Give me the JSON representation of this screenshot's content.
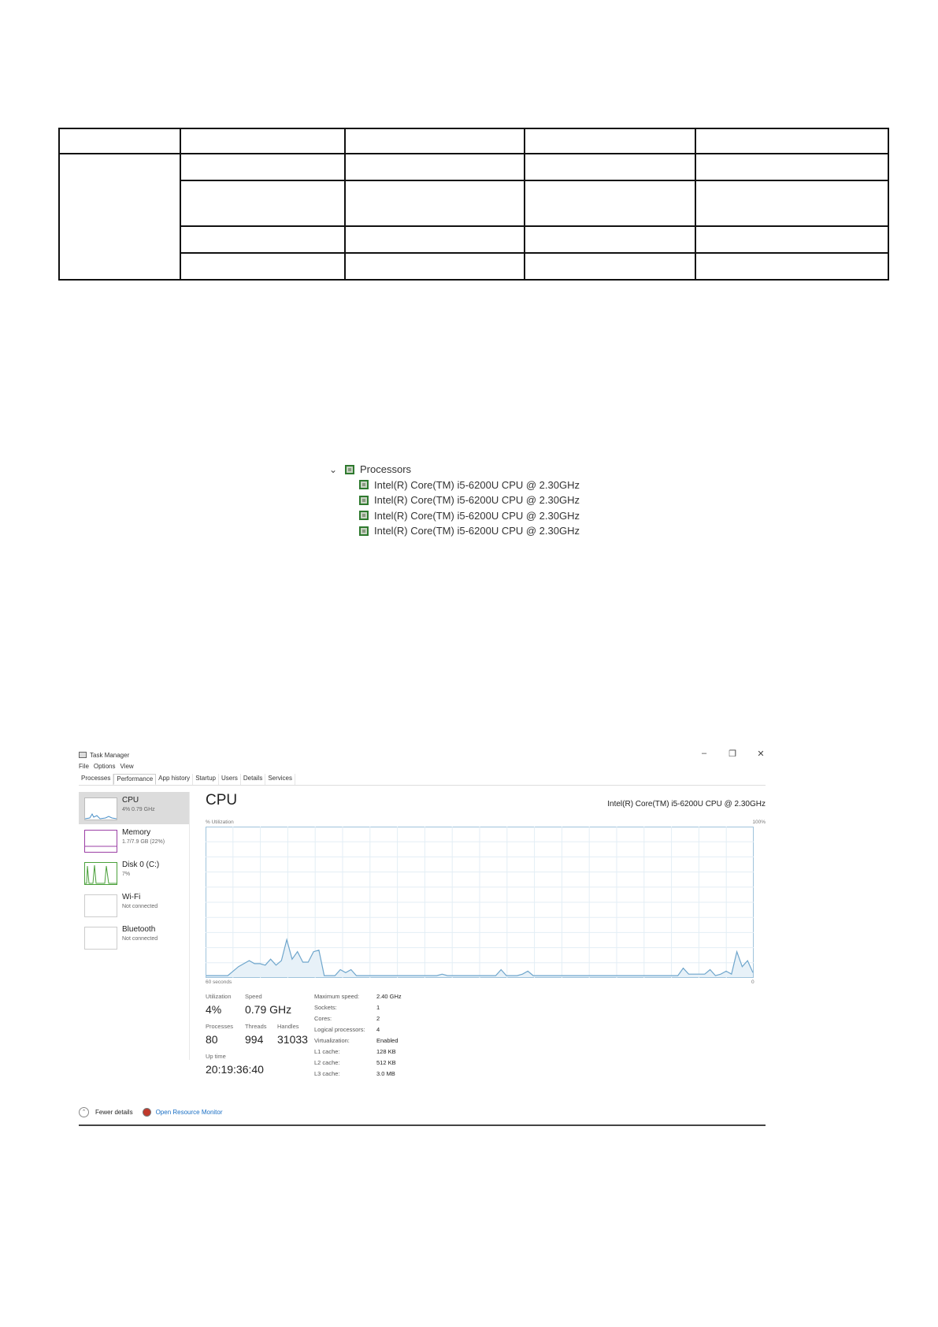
{
  "processors_tree": {
    "root_label": "Processors",
    "children": [
      "Intel(R) Core(TM) i5-6200U CPU @ 2.30GHz",
      "Intel(R) Core(TM) i5-6200U CPU @ 2.30GHz",
      "Intel(R) Core(TM) i5-6200U CPU @ 2.30GHz",
      "Intel(R) Core(TM) i5-6200U CPU @ 2.30GHz"
    ]
  },
  "task_manager": {
    "title": "Task Manager",
    "window_controls": [
      "–",
      "❐",
      "✕"
    ],
    "menu": [
      "File",
      "Options",
      "View"
    ],
    "tabs": [
      "Processes",
      "Performance",
      "App history",
      "Startup",
      "Users",
      "Details",
      "Services"
    ],
    "active_tab": "Performance",
    "sidebar": [
      {
        "name": "CPU",
        "sub": "4% 0.79 GHz",
        "color": "#4a90c8"
      },
      {
        "name": "Memory",
        "sub": "1.7/7.9 GB (22%)",
        "color": "#9b3fa5"
      },
      {
        "name": "Disk 0 (C:)",
        "sub": "7%",
        "color": "#4aa03a"
      },
      {
        "name": "Wi-Fi",
        "sub": "Not connected",
        "color": "#999999"
      },
      {
        "name": "Bluetooth",
        "sub": "Not connected",
        "color": "#999999"
      }
    ],
    "main": {
      "title": "CPU",
      "model": "Intel(R) Core(TM) i5-6200U CPU @ 2.30GHz",
      "axis_top_left": "% Utilization",
      "axis_top_right": "100%",
      "axis_bottom_left": "60 seconds",
      "axis_bottom_right": "0"
    },
    "stats": {
      "utilization_label": "Utilization",
      "utilization": "4%",
      "speed_label": "Speed",
      "speed": "0.79 GHz",
      "processes_label": "Processes",
      "processes": "80",
      "threads_label": "Threads",
      "threads": "994",
      "handles_label": "Handles",
      "handles": "31033",
      "uptime_label": "Up time",
      "uptime": "20:19:36:40"
    },
    "details": [
      {
        "k": "Maximum speed:",
        "v": "2.40 GHz"
      },
      {
        "k": "Sockets:",
        "v": "1"
      },
      {
        "k": "Cores:",
        "v": "2"
      },
      {
        "k": "Logical processors:",
        "v": "4"
      },
      {
        "k": "Virtualization:",
        "v": "Enabled"
      },
      {
        "k": "L1 cache:",
        "v": "128 KB"
      },
      {
        "k": "L2 cache:",
        "v": "512 KB"
      },
      {
        "k": "L3 cache:",
        "v": "3.0 MB"
      }
    ],
    "footer": {
      "fewer": "Fewer details",
      "resource_monitor": "Open Resource Monitor"
    }
  },
  "chart_data": {
    "type": "area",
    "ylim": [
      0,
      100
    ],
    "values": [
      1,
      1,
      1,
      1,
      1,
      4,
      7,
      9,
      11,
      9,
      9,
      8,
      12,
      8,
      11,
      25,
      12,
      17,
      10,
      10,
      17,
      18,
      1,
      1,
      1,
      5,
      3,
      5,
      1,
      1,
      1,
      1,
      1,
      1,
      1,
      1,
      1,
      1,
      1,
      1,
      1,
      1,
      1,
      1,
      2,
      1,
      1,
      1,
      1,
      1,
      1,
      1,
      1,
      1,
      1,
      5,
      1,
      1,
      1,
      2,
      4,
      1,
      1,
      1,
      1,
      1,
      1,
      1,
      1,
      1,
      1,
      1,
      1,
      1,
      1,
      1,
      1,
      1,
      1,
      1,
      1,
      1,
      1,
      1,
      1,
      1,
      1,
      1,
      1,
      6,
      2,
      2,
      2,
      2,
      5,
      1,
      2,
      4,
      2,
      17,
      7,
      11,
      3
    ]
  }
}
